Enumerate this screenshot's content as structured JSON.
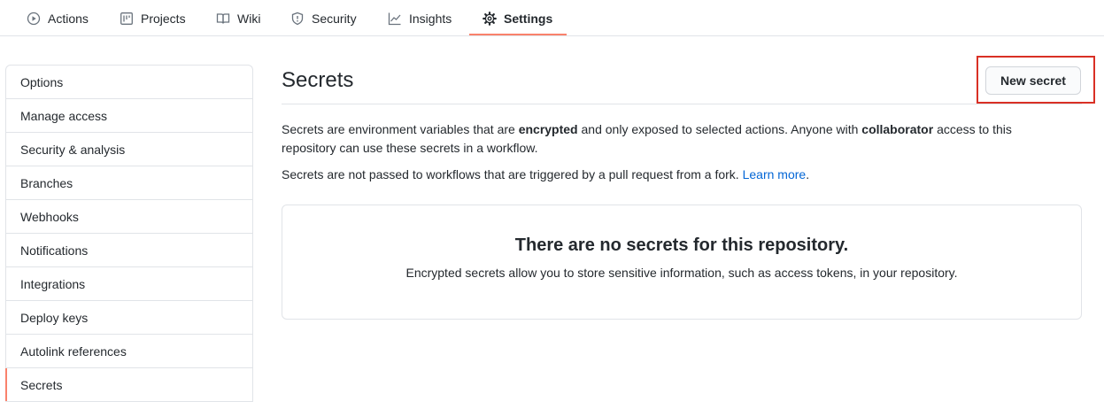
{
  "topnav": {
    "tabs": [
      {
        "label": "Actions",
        "icon": "play-icon"
      },
      {
        "label": "Projects",
        "icon": "project-icon"
      },
      {
        "label": "Wiki",
        "icon": "book-icon"
      },
      {
        "label": "Security",
        "icon": "shield-icon"
      },
      {
        "label": "Insights",
        "icon": "graph-icon"
      },
      {
        "label": "Settings",
        "icon": "gear-icon",
        "selected": true
      }
    ],
    "accent_color": "#f9826c"
  },
  "sidebar": {
    "items": [
      {
        "label": "Options"
      },
      {
        "label": "Manage access"
      },
      {
        "label": "Security & analysis"
      },
      {
        "label": "Branches"
      },
      {
        "label": "Webhooks"
      },
      {
        "label": "Notifications"
      },
      {
        "label": "Integrations"
      },
      {
        "label": "Deploy keys"
      },
      {
        "label": "Autolink references"
      },
      {
        "label": "Secrets",
        "selected": true
      }
    ]
  },
  "main": {
    "title": "Secrets",
    "new_secret_label": "New secret",
    "highlight_color": "#d93025",
    "description": {
      "p1_part1": "Secrets are environment variables that are ",
      "p1_bold1": "encrypted",
      "p1_part2": " and only exposed to selected actions. Anyone with ",
      "p1_bold2": "collaborator",
      "p1_part3": " access to this repository can use these secrets in a workflow.",
      "p2_text": "Secrets are not passed to workflows that are triggered by a pull request from a fork. ",
      "p2_link": "Learn more",
      "p2_end": "."
    },
    "blankslate": {
      "heading": "There are no secrets for this repository.",
      "text": "Encrypted secrets allow you to store sensitive information, such as access tokens, in your repository."
    }
  }
}
